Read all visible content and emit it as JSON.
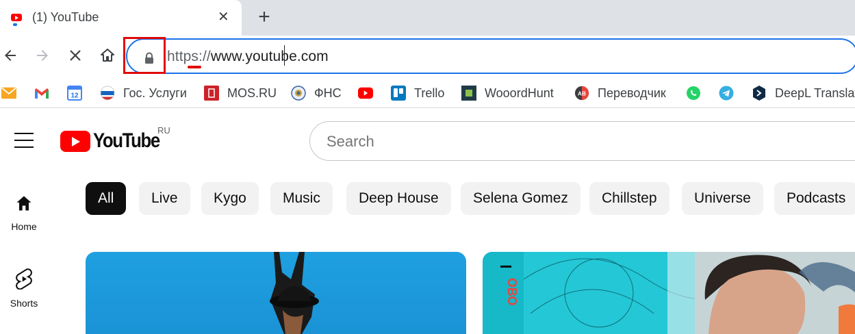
{
  "browser": {
    "tab": {
      "title": "(1) YouTube",
      "close_glyph": "✕"
    },
    "new_tab_glyph": "+",
    "address_bar": {
      "scheme": "https://",
      "host": "www.youtube.com"
    },
    "bookmarks": [
      {
        "label": "",
        "icon": "mail-icon"
      },
      {
        "label": "",
        "icon": "gmail-icon"
      },
      {
        "label": "",
        "icon": "calendar-icon",
        "badge": "12"
      },
      {
        "label": "Гос. Услуги",
        "icon": "gosuslugi-icon"
      },
      {
        "label": "MOS.RU",
        "icon": "mos-ru-icon"
      },
      {
        "label": "ФНС",
        "icon": "fns-icon"
      },
      {
        "label": "",
        "icon": "youtube-icon"
      },
      {
        "label": "Trello",
        "icon": "trello-icon"
      },
      {
        "label": "WooordHunt",
        "icon": "wooordhunt-icon"
      },
      {
        "label": "Переводчик",
        "icon": "translator-icon"
      },
      {
        "label": "",
        "icon": "whatsapp-icon"
      },
      {
        "label": "",
        "icon": "telegram-icon"
      },
      {
        "label": "DeepL Translat",
        "icon": "deepl-icon"
      }
    ]
  },
  "youtube": {
    "logo_text": "YouTube",
    "country_code": "RU",
    "search": {
      "placeholder": "Search"
    },
    "sidebar": [
      {
        "label": "Home",
        "icon": "home-icon"
      },
      {
        "label": "Shorts",
        "icon": "shorts-icon"
      }
    ],
    "chips": [
      "All",
      "Live",
      "Kygo",
      "Music",
      "Deep House",
      "Selena Gomez",
      "Chillstep",
      "Universe",
      "Podcasts"
    ],
    "active_chip": "All",
    "thumbnails": [
      {
        "overlay_text": ""
      },
      {
        "overlay_text": "ОВО"
      }
    ]
  },
  "colors": {
    "accent_blue": "#1a73e8",
    "highlight_red": "#e10a0a",
    "youtube_red": "#ff0000"
  }
}
